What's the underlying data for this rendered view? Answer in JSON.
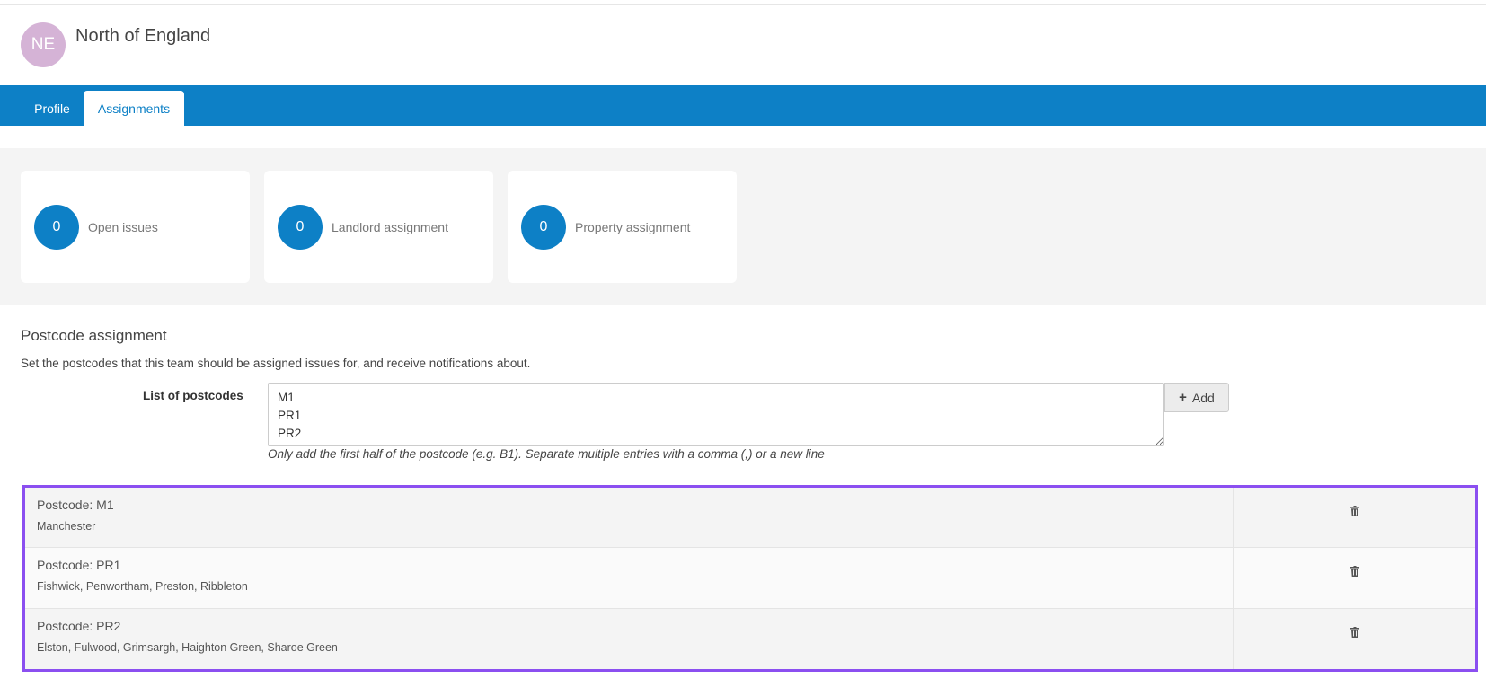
{
  "team": {
    "initials": "NE",
    "name": "North of England"
  },
  "tabs": [
    {
      "label": "Profile"
    },
    {
      "label": "Assignments"
    }
  ],
  "stats": [
    {
      "count": "0",
      "label": "Open issues"
    },
    {
      "count": "0",
      "label": "Landlord assignment"
    },
    {
      "count": "0",
      "label": "Property assignment"
    }
  ],
  "postcode_section": {
    "title": "Postcode assignment",
    "description": "Set the postcodes that this team should be assigned issues for, and receive notifications about.",
    "field_label": "List of postcodes",
    "field_value": "M1\nPR1\nPR2",
    "add_label": "Add",
    "help_text": "Only add the first half of the postcode (e.g. B1). Separate multiple entries with a comma (,) or a new line"
  },
  "assignments": [
    {
      "postcode": "Postcode: M1",
      "areas": "Manchester"
    },
    {
      "postcode": "Postcode: PR1",
      "areas": "Fishwick, Penwortham, Preston, Ribbleton"
    },
    {
      "postcode": "Postcode: PR2",
      "areas": "Elston, Fulwood, Grimsargh, Haighton Green, Sharoe Green"
    }
  ],
  "colors": {
    "primary": "#0d80c6",
    "avatar": "#d5b3d6",
    "highlight": "#8b4ff0"
  }
}
